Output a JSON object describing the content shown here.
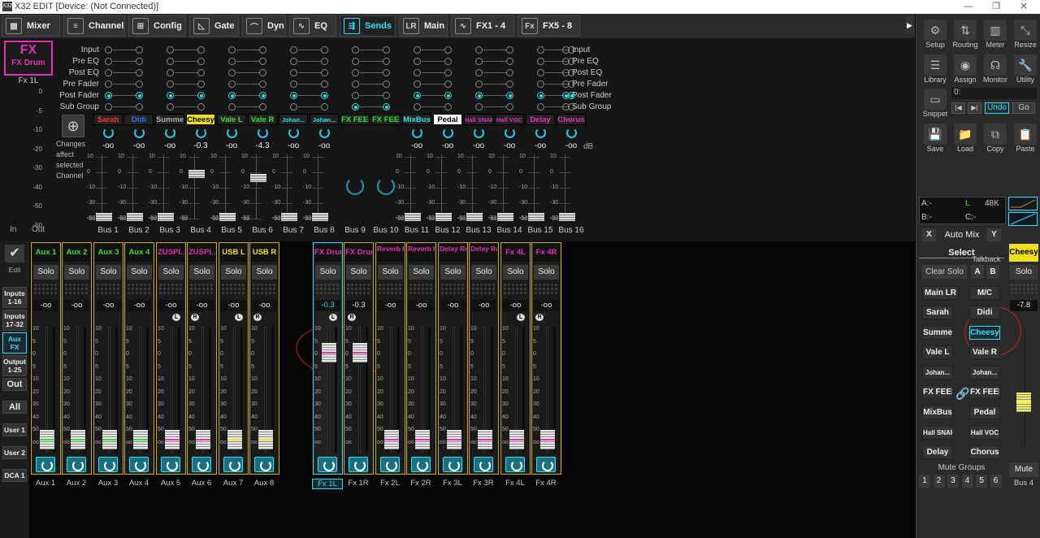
{
  "window": {
    "title": "X32 EDIT [Device: (Not Connected)]",
    "icon_text": "X32"
  },
  "tabs": [
    {
      "label": "Mixer",
      "icon": "mixer-icon",
      "glyph": "▦"
    },
    {
      "label": "Channel",
      "icon": "channel-icon",
      "glyph": "≡"
    },
    {
      "label": "Config",
      "icon": "config-icon",
      "glyph": "⊞"
    },
    {
      "label": "Gate",
      "icon": "gate-icon",
      "glyph": "◺"
    },
    {
      "label": "Dyn",
      "icon": "dyn-icon",
      "glyph": "⌒"
    },
    {
      "label": "EQ",
      "icon": "eq-icon",
      "glyph": "∿"
    },
    {
      "label": "Sends",
      "icon": "sends-icon",
      "glyph": "⇶"
    },
    {
      "label": "Main",
      "icon": "main-icon",
      "glyph": "LR"
    },
    {
      "label": "FX1 - 4",
      "icon": "fx-icon",
      "glyph": "∿"
    },
    {
      "label": "FX5 - 8",
      "icon": "fx-icon",
      "glyph": "Fx"
    }
  ],
  "sends": {
    "fx_badge": {
      "icon": "FX",
      "name": "FX Drum"
    },
    "fx_sub": "Fx 1L",
    "meter_scale": [
      "0",
      "-5",
      "-10",
      "-20",
      "-30",
      "-40",
      "-50",
      "-60"
    ],
    "in_label": "In",
    "out_label": "Out",
    "tap_rows": [
      "Input",
      "Pre EQ",
      "Post EQ",
      "Pre Fader",
      "Post Fader",
      "Sub Group"
    ],
    "changes_text": "Changes affect selected Channel",
    "db_label": "dB",
    "fader_scale": [
      "10",
      "0",
      "-10",
      "-30",
      "-50",
      "-oo"
    ],
    "buses": [
      {
        "name": "Sarah",
        "color": "#ff3030",
        "level": "-oo",
        "bus": "Bus 1",
        "cap": 0.0
      },
      {
        "name": "Didi",
        "color": "#3070ff",
        "level": "-oo",
        "bus": "Bus 2",
        "cap": 0.0
      },
      {
        "name": "Summe",
        "color": "#aaaaaa",
        "level": "-oo",
        "bus": "Bus 3",
        "cap": 0.0
      },
      {
        "name": "Cheesy",
        "color": "#f0e020",
        "level": "-0.3",
        "bus": "Bus 4",
        "cap": 0.74
      },
      {
        "name": "Vale L",
        "color": "#30e030",
        "level": "-oo",
        "bus": "Bus 5",
        "cap": 0.0
      },
      {
        "name": "Vale R",
        "color": "#30e030",
        "level": "-4.3",
        "bus": "Bus 6",
        "cap": 0.66
      },
      {
        "name": "Johan...",
        "color": "#25e0e8",
        "level": "-oo",
        "bus": "Bus 7",
        "cap": 0.0
      },
      {
        "name": "Johan...",
        "color": "#25e0e8",
        "level": "-oo",
        "bus": "Bus 8",
        "cap": 0.0
      },
      {
        "name": "FX FEED",
        "color": "#30e030",
        "level": "",
        "bus": "Bus 9",
        "cap": -1
      },
      {
        "name": "FX FEED",
        "color": "#30e030",
        "level": "",
        "bus": "Bus 10",
        "cap": -1
      },
      {
        "name": "MixBus",
        "color": "#25e0e8",
        "level": "-oo",
        "bus": "Bus 11",
        "cap": 0.0
      },
      {
        "name": "Pedal",
        "color": "#ffffff",
        "level": "-oo",
        "bus": "Bus 12",
        "cap": 0.0
      },
      {
        "name": "Hall SNARE",
        "color": "#e62db6",
        "level": "-oo",
        "bus": "Bus 13",
        "cap": 0.0
      },
      {
        "name": "Hall VOC",
        "color": "#e62db6",
        "level": "-oo",
        "bus": "Bus 14",
        "cap": 0.0
      },
      {
        "name": "Delay",
        "color": "#e62db6",
        "level": "-oo",
        "bus": "Bus 15",
        "cap": 0.0
      },
      {
        "name": "Chorus",
        "color": "#e62db6",
        "level": "-oo",
        "bus": "Bus 16",
        "cap": 0.0
      }
    ]
  },
  "right_panel": {
    "buttons": [
      {
        "label": "Setup",
        "icon": "gear-icon",
        "glyph": "⚙"
      },
      {
        "label": "Routing",
        "icon": "routing-icon",
        "glyph": "⇅"
      },
      {
        "label": "Meter",
        "icon": "meter-icon",
        "glyph": "▥"
      },
      {
        "label": "Resize",
        "icon": "resize-icon",
        "glyph": "⤡"
      },
      {
        "label": "Library",
        "icon": "library-icon",
        "glyph": "☰"
      },
      {
        "label": "Assign",
        "icon": "assign-icon",
        "glyph": "◉"
      },
      {
        "label": "Monitor",
        "icon": "headphones-icon",
        "glyph": "☊"
      },
      {
        "label": "Utility",
        "icon": "wrench-icon",
        "glyph": "🔧"
      },
      {
        "label": "Snippet",
        "icon": "snippet-icon",
        "glyph": "▭"
      },
      {
        "label": "Save",
        "icon": "save-icon",
        "glyph": "💾"
      },
      {
        "label": "Load",
        "icon": "folder-icon",
        "glyph": "📁"
      },
      {
        "label": "Copy",
        "icon": "copy-icon",
        "glyph": "⧉"
      },
      {
        "label": "Paste",
        "icon": "paste-icon",
        "glyph": "📋"
      }
    ],
    "scene_field": "0:",
    "undo": "Undo",
    "go": "Go",
    "status": {
      "a": "A:-",
      "l": "L",
      "rate": "48K",
      "b": "B:-",
      "c": "C:-"
    },
    "automix": {
      "x": "X",
      "label": "Auto Mix",
      "y": "Y"
    },
    "select_label": "Select",
    "talkback": "Talkback",
    "clear_solo": "Clear Solo",
    "tb_a": "A",
    "tb_b": "B",
    "main_lr": "Main LR",
    "mc": "M/C",
    "select_buttons": [
      {
        "label": "Sarah",
        "color": "#ff3030"
      },
      {
        "label": "Didi",
        "color": "#3070ff"
      },
      {
        "label": "Summe",
        "color": "#888888"
      },
      {
        "label": "Cheesy",
        "color": "#f0e020"
      },
      {
        "label": "Vale L",
        "color": "#30e030"
      },
      {
        "label": "Vale R",
        "color": "#30e030"
      },
      {
        "label": "Johan...",
        "color": "#25e0e8"
      },
      {
        "label": "Johan...",
        "color": "#25e0e8"
      },
      {
        "label": "FX FEED",
        "color": "#30e030"
      },
      {
        "label": "FX FEED",
        "color": "#30e030"
      },
      {
        "label": "MixBus",
        "color": "#25e0e8"
      },
      {
        "label": "Pedal",
        "color": "#ffffff"
      },
      {
        "label": "Hall SNARE",
        "color": "#e62db6"
      },
      {
        "label": "Hall VOC",
        "color": "#e62db6"
      },
      {
        "label": "Delay",
        "color": "#e62db6"
      },
      {
        "label": "Chorus",
        "color": "#e62db6"
      }
    ],
    "mute_groups_label": "Mute Groups",
    "mute_groups": [
      "1",
      "2",
      "3",
      "4",
      "5",
      "6"
    ],
    "main_channel": {
      "name": "Cheesy",
      "solo": "Solo",
      "level": "-7.8",
      "mute": "Mute",
      "bus": "Bus 4",
      "cap": 0.38
    }
  },
  "left_nav": [
    {
      "label": "Edit"
    },
    {
      "label": "Inputs 1-16"
    },
    {
      "label": "Inputs 17-32"
    },
    {
      "label": "Aux FX"
    },
    {
      "label": "Output 1-25"
    },
    {
      "label": "Out"
    },
    {
      "label": "All"
    },
    {
      "label": "User 1"
    },
    {
      "label": "User 2"
    },
    {
      "label": "DCA 1"
    }
  ],
  "strips": {
    "solo_label": "Solo",
    "scale": [
      "10",
      "5",
      "0",
      "5",
      "10",
      "20",
      "30",
      "40",
      "50",
      "oo"
    ],
    "channels": [
      {
        "name": "Aux 1",
        "color": "#30e030",
        "level": "-oo",
        "foot": "Aux 1",
        "lr": "",
        "cap": 0.0
      },
      {
        "name": "Aux 2",
        "color": "#30e030",
        "level": "-oo",
        "foot": "Aux 2",
        "lr": "",
        "cap": 0.0
      },
      {
        "name": "Aux 3",
        "color": "#30e030",
        "level": "-oo",
        "foot": "Aux 3",
        "lr": "",
        "cap": 0.0
      },
      {
        "name": "Aux 4",
        "color": "#30e030",
        "level": "-oo",
        "foot": "Aux 4",
        "lr": "",
        "cap": 0.0
      },
      {
        "name": "ZUSPI...",
        "color": "#e62db6",
        "level": "-oo",
        "foot": "Aux 5",
        "lr": "L",
        "cap": 0.0
      },
      {
        "name": "ZUSPI...",
        "color": "#e62db6",
        "level": "-oo",
        "foot": "Aux 6",
        "lr": "R",
        "cap": 0.0
      },
      {
        "name": "USB L",
        "color": "#f0e020",
        "level": "-oo",
        "foot": "Aux 7",
        "lr": "L",
        "cap": 0.0
      },
      {
        "name": "USB R",
        "color": "#f0e020",
        "level": "-oo",
        "foot": "Aux 8",
        "lr": "R",
        "cap": 0.0
      },
      {
        "name": "FX Drum",
        "color": "#e62db6",
        "level": "-0.3",
        "foot": "Fx 1L",
        "lr": "L",
        "cap": 0.74
      },
      {
        "name": "FX Drum",
        "color": "#e62db6",
        "level": "-0.3",
        "foot": "Fx 1R",
        "lr": "R",
        "cap": 0.74
      },
      {
        "name": "Reverb Ret",
        "color": "#e62db6",
        "level": "-oo",
        "foot": "Fx 2L",
        "lr": "",
        "cap": 0.0
      },
      {
        "name": "Reverb Ret",
        "color": "#e62db6",
        "level": "-oo",
        "foot": "Fx 2R",
        "lr": "",
        "cap": 0.0
      },
      {
        "name": "Delay Ret",
        "color": "#e62db6",
        "level": "-oo",
        "foot": "Fx 3L",
        "lr": "",
        "cap": 0.0
      },
      {
        "name": "Delay Ret",
        "color": "#e62db6",
        "level": "-oo",
        "foot": "Fx 3R",
        "lr": "",
        "cap": 0.0
      },
      {
        "name": "Fx 4L",
        "color": "#e62db6",
        "level": "-oo",
        "foot": "Fx 4L",
        "lr": "L",
        "cap": 0.0
      },
      {
        "name": "Fx 4R",
        "color": "#e62db6",
        "level": "-oo",
        "foot": "Fx 4R",
        "lr": "R",
        "cap": 0.0
      }
    ]
  }
}
